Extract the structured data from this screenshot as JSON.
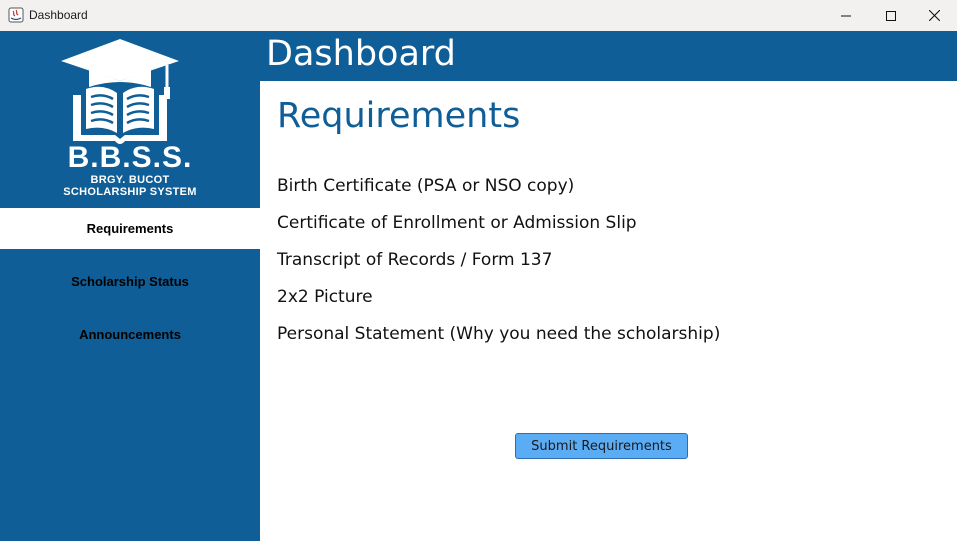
{
  "window": {
    "title": "Dashboard",
    "icon": "java-app-icon",
    "controls": [
      "minimize-icon",
      "maximize-icon",
      "close-icon"
    ]
  },
  "sidebar": {
    "logo_icon": "graduation-cap-book-icon",
    "brand": {
      "acronym": "B.B.S.S.",
      "line1": "BRGY. BUCOT",
      "line2": "SCHOLARSHIP SYSTEM"
    },
    "items": [
      {
        "label": "Requirements",
        "active": true
      },
      {
        "label": "Scholarship Status",
        "active": false
      },
      {
        "label": "Announcements",
        "active": false
      }
    ]
  },
  "header": {
    "title": "Dashboard"
  },
  "main": {
    "title": "Requirements",
    "requirements": [
      "Birth Certificate (PSA or NSO copy)",
      "Certificate of Enrollment or Admission Slip",
      "Transcript of Records / Form 137",
      "2x2 Picture",
      "Personal Statement (Why you need the scholarship)"
    ],
    "submit_label": "Submit Requirements"
  },
  "colors": {
    "primary": "#0f5e97",
    "button": "#5aacf5",
    "titlebar": "#f3f1ef",
    "text": "#111111"
  }
}
